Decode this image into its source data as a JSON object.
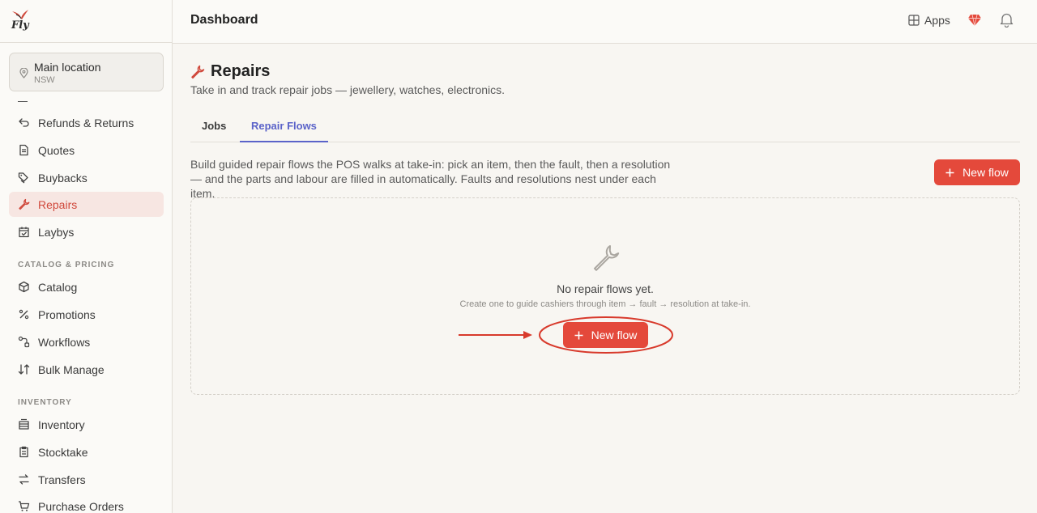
{
  "brand": {
    "logo_text": "Fly"
  },
  "location": {
    "name": "Main location",
    "region": "NSW"
  },
  "sidebar": {
    "items": [
      {
        "label": "Refunds & Returns",
        "icon": "undo-icon"
      },
      {
        "label": "Quotes",
        "icon": "document-icon"
      },
      {
        "label": "Buybacks",
        "icon": "tags-icon"
      },
      {
        "label": "Repairs",
        "icon": "wrench-icon",
        "active": true
      },
      {
        "label": "Laybys",
        "icon": "calendar-icon"
      }
    ],
    "catalog_section": "CATALOG & PRICING",
    "catalog_items": [
      {
        "label": "Catalog",
        "icon": "box-icon"
      },
      {
        "label": "Promotions",
        "icon": "percent-icon"
      },
      {
        "label": "Workflows",
        "icon": "workflow-icon"
      },
      {
        "label": "Bulk Manage",
        "icon": "sort-icon"
      }
    ],
    "inventory_section": "INVENTORY",
    "inventory_items": [
      {
        "label": "Inventory",
        "icon": "layers-icon"
      },
      {
        "label": "Stocktake",
        "icon": "clipboard-icon"
      },
      {
        "label": "Transfers",
        "icon": "transfer-icon"
      },
      {
        "label": "Purchase Orders",
        "icon": "cart-icon"
      }
    ]
  },
  "topbar": {
    "title": "Dashboard",
    "apps_label": "Apps"
  },
  "page": {
    "title": "Repairs",
    "subtitle": "Take in and track repair jobs — jewellery, watches, electronics.",
    "tabs": [
      {
        "label": "Jobs",
        "active": false
      },
      {
        "label": "Repair Flows",
        "active": true
      }
    ],
    "description": "Build guided repair flows the POS walks at take-in: pick an item, then the fault, then a resolution — and the parts and labour are filled in automatically. Faults and resolutions nest under each item.",
    "new_flow_label": "New flow",
    "empty_title": "No repair flows yet.",
    "empty_subtitle": "Create one to guide cashiers through item → fault → resolution at take-in.",
    "empty_button_label": "New flow"
  },
  "colors": {
    "accent": "#e4493b",
    "tab_active": "#5b63c9",
    "sidebar_active_bg": "#f7e6e2"
  }
}
